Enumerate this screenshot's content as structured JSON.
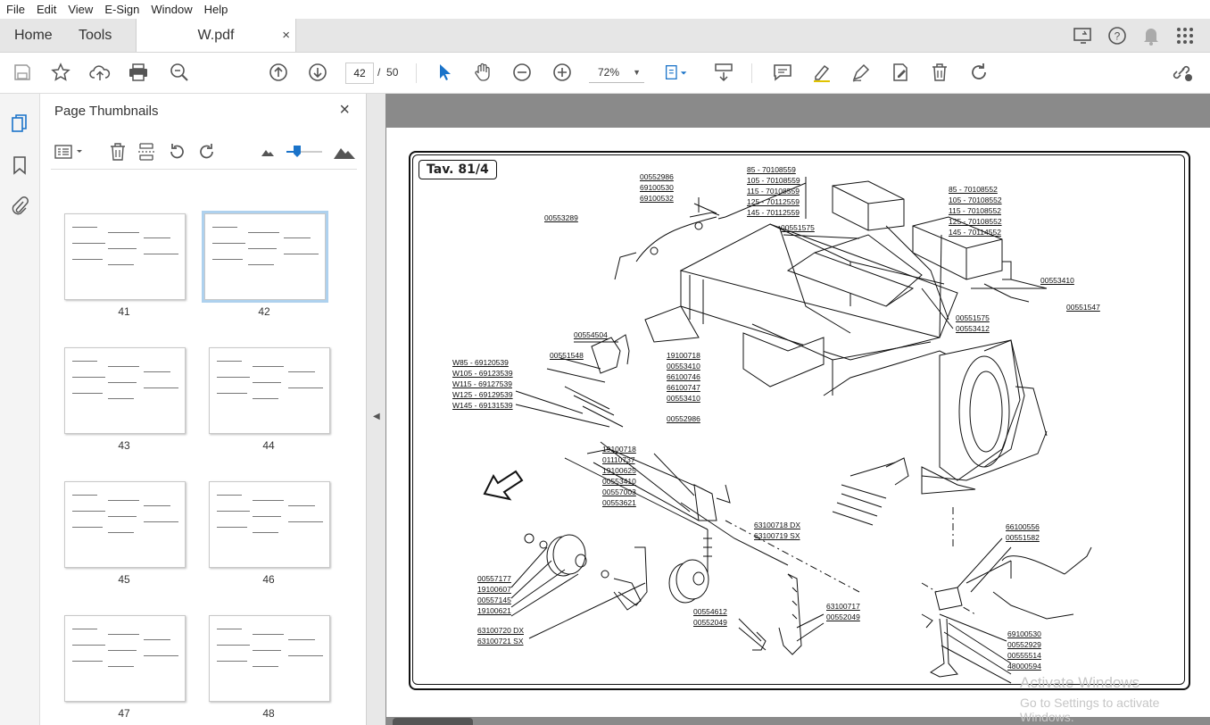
{
  "menu": [
    "File",
    "Edit",
    "View",
    "E-Sign",
    "Window",
    "Help"
  ],
  "tabs": {
    "home": "Home",
    "tools": "Tools",
    "document": "W.pdf",
    "close": "×"
  },
  "toolbar": {
    "current_page": "42",
    "separator": "/",
    "total_pages": "50",
    "zoom": "72%"
  },
  "panel": {
    "title": "Page Thumbnails",
    "close": "×",
    "thumbnails": [
      {
        "label": "41",
        "selected": false
      },
      {
        "label": "42",
        "selected": true
      },
      {
        "label": "43",
        "selected": false
      },
      {
        "label": "44",
        "selected": false
      },
      {
        "label": "45",
        "selected": false
      },
      {
        "label": "46",
        "selected": false
      },
      {
        "label": "47",
        "selected": false
      },
      {
        "label": "48",
        "selected": false
      }
    ]
  },
  "drawing": {
    "title": "Tav. 81/4",
    "parts": [
      "00552986",
      "69100530",
      "69100532",
      "00553289",
      "85 - 70108559",
      "105 - 70108559",
      "115 - 70108559",
      "125 - 70112559",
      "145 - 70112559",
      "85 - 70108552",
      "105 - 70108552",
      "115 - 70108552",
      "125 - 70108552",
      "145 - 70114552",
      "00551575",
      "00553410",
      "00551547",
      "00551575",
      "00553412",
      "00554504",
      "00551548",
      "19100718",
      "00553410",
      "66100746",
      "66100747",
      "00553410",
      "00552986",
      "W85 - 69120539",
      "W105 - 69123539",
      "W115 - 69127539",
      "W125 - 69129539",
      "W145 - 69131539",
      "19100718",
      "01110737",
      "19100625",
      "00553410",
      "00557003",
      "00553621",
      "63100718 DX",
      "63100719 SX",
      "66100556",
      "00551582",
      "00557177",
      "19100607",
      "00557145",
      "19100621",
      "63100720 DX",
      "63100721 SX",
      "00554612",
      "00552049",
      "63100717",
      "00552049",
      "69100530",
      "00552929",
      "00555514",
      "48000594"
    ]
  },
  "watermark": {
    "line1": "Activate Windows",
    "line2": "Go to Settings to activate Windows."
  }
}
